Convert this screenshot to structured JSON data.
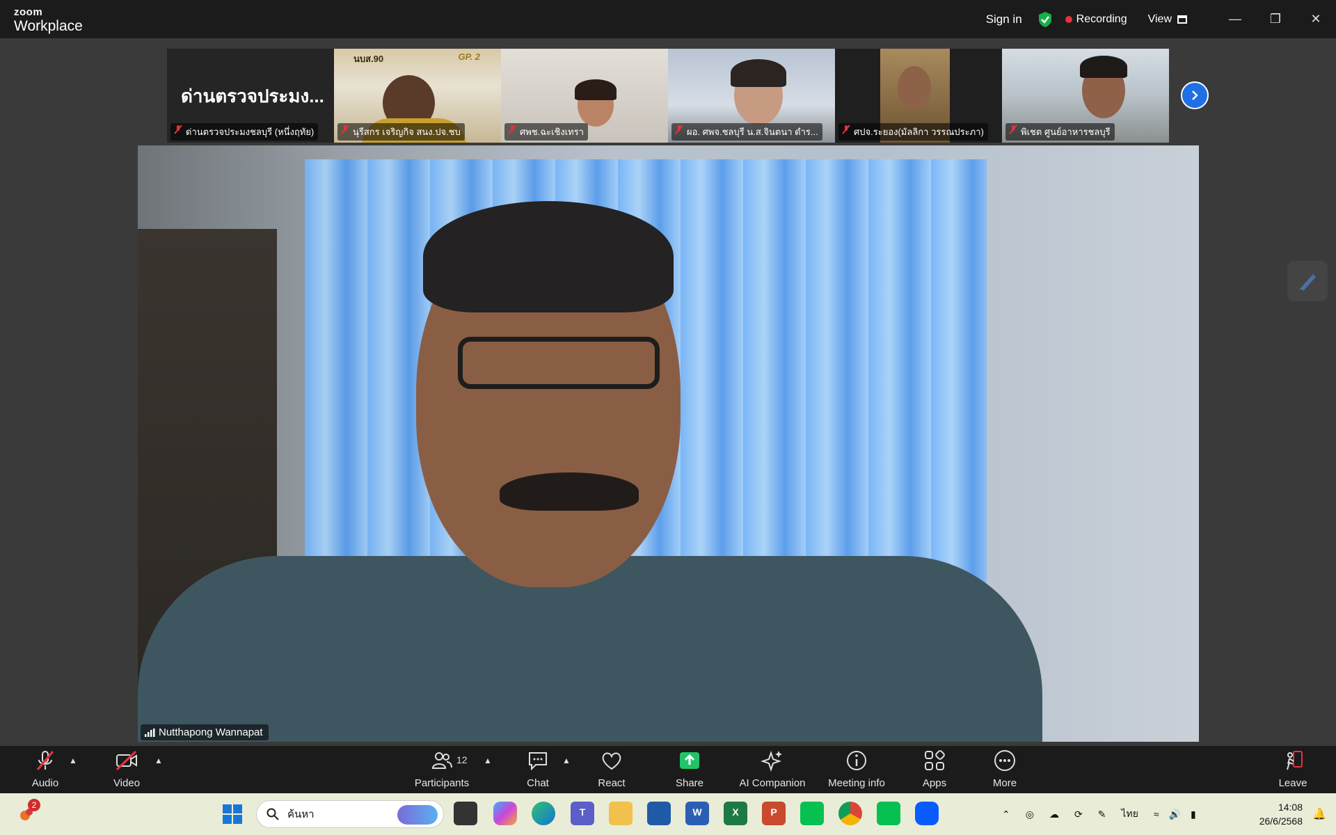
{
  "app": {
    "logo_small": "zoom",
    "logo_big": "Workplace",
    "sign_in": "Sign in",
    "recording": "Recording",
    "view": "View",
    "window_controls": [
      "minimize-icon",
      "restore-icon",
      "close-icon"
    ]
  },
  "thumbnails": [
    {
      "name": "ด่านตรวจประมงชลบุรี (หนึ่งฤทัย)",
      "display_text": "ด่านตรวจประมง..."
    },
    {
      "name": "นุรีสกร เจริญกิจ สนง.ปจ.ชบ",
      "overlay_left": "นบส.90",
      "overlay_right": "GP. 2"
    },
    {
      "name": "ศพช.ฉะเชิงเทรา"
    },
    {
      "name": "ผอ. ศพจ.ชลบุรี น.ส.จินตนา ดำร..."
    },
    {
      "name": "ศปจ.ระยอง(มัลลิกา วรรณประภา)"
    },
    {
      "name": "พิเชต ศูนย์อาหารชลบุรี"
    }
  ],
  "main_video": {
    "speaker": "Nutthapong Wannapat"
  },
  "toolbar": {
    "audio": "Audio",
    "video": "Video",
    "participants": "Participants",
    "participants_count": "12",
    "chat": "Chat",
    "react": "React",
    "share": "Share",
    "ai_companion": "AI Companion",
    "meeting_info": "Meeting info",
    "apps": "Apps",
    "more": "More",
    "leave": "Leave"
  },
  "taskbar": {
    "notification_count": "2",
    "search_placeholder": "ค้นหา",
    "language": "ไทย",
    "time": "14:08",
    "date": "26/6/2568",
    "apps": [
      "file-explorer-dark",
      "copilot",
      "edge",
      "teams",
      "file-explorer",
      "store",
      "word",
      "excel",
      "powerpoint",
      "line",
      "chrome",
      "line",
      "zoom"
    ]
  },
  "colors": {
    "accent_blue": "#1f6fe5",
    "recording_red": "#e8323c",
    "share_green": "#20c568",
    "shield_green": "#17b04a",
    "leave_red": "#e8323c"
  }
}
